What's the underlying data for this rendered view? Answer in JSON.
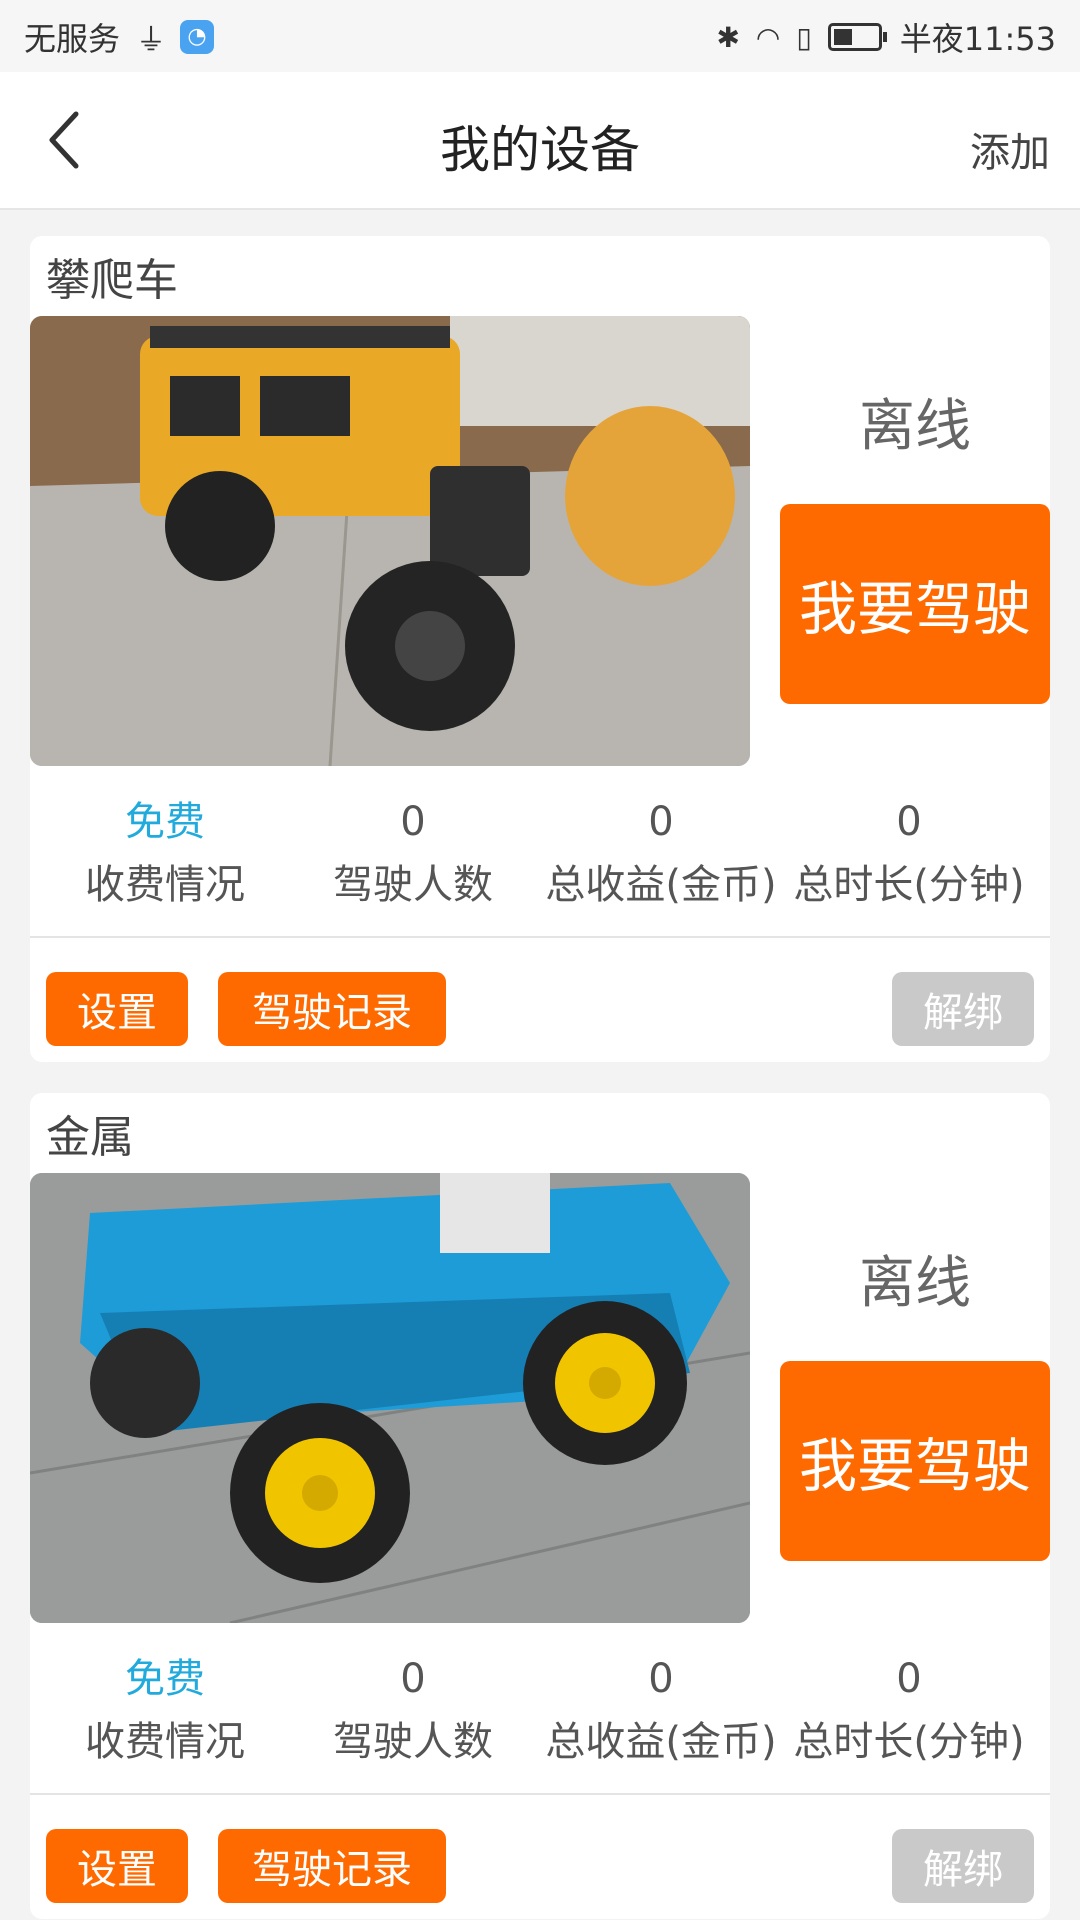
{
  "status_bar": {
    "carrier": "无服务",
    "usb_icon": "usb-icon",
    "app_icon": "app-notification-icon",
    "bluetooth_icon": "bluetooth-icon",
    "wifi_icon": "wifi-icon",
    "alert_icon": "alert-icon",
    "battery_icon": "battery-icon",
    "time": "半夜11:53"
  },
  "nav": {
    "back_icon": "back-arrow-icon",
    "title": "我的设备",
    "add_label": "添加"
  },
  "devices": [
    {
      "name": "攀爬车",
      "photo": "yellow-offroad-rc-crawler-photo",
      "status": "离线",
      "drive_label": "我要驾驶",
      "stats": [
        {
          "value": "免费",
          "label": "收费情况"
        },
        {
          "value": "0",
          "label": "驾驶人数"
        },
        {
          "value": "0",
          "label": "总收益(金币)"
        },
        {
          "value": "0",
          "label": "总时长(分钟)"
        }
      ],
      "buttons": {
        "settings": "设置",
        "records": "驾驶记录",
        "unbind": "解绑"
      }
    },
    {
      "name": "金属",
      "photo": "blue-metal-robot-car-photo",
      "status": "离线",
      "drive_label": "我要驾驶",
      "stats": [
        {
          "value": "免费",
          "label": "收费情况"
        },
        {
          "value": "0",
          "label": "驾驶人数"
        },
        {
          "value": "0",
          "label": "总收益(金币)"
        },
        {
          "value": "0",
          "label": "总时长(分钟)"
        }
      ],
      "buttons": {
        "settings": "设置",
        "records": "驾驶记录",
        "unbind": "解绑"
      }
    }
  ],
  "colors": {
    "accent": "#ff6a00",
    "free_text": "#22aadd",
    "disabled_button": "#c9c9c9"
  }
}
